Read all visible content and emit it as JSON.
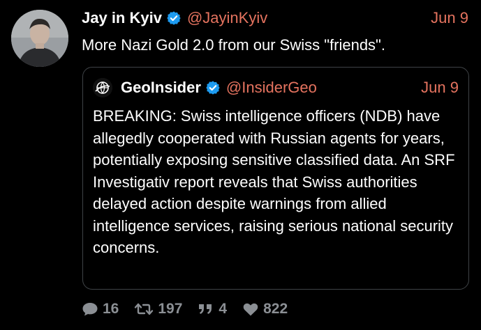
{
  "tweet": {
    "author_name": "Jay in Kyiv",
    "author_handle": "@JayinKyiv",
    "date": "Jun 9",
    "text": "More Nazi Gold 2.0 from our Swiss \"friends\".",
    "avatar_icon": "person-photo-avatar",
    "verified_icon": "verified-badge-icon"
  },
  "quoted": {
    "author_name": "GeoInsider",
    "author_handle": "@InsiderGeo",
    "date": "Jun 9",
    "avatar_icon": "globe-logo-avatar",
    "text": "BREAKING: Swiss intelligence officers (NDB) have allegedly cooperated with Russian agents for years, potentially exposing sensitive classified data. An SRF Investigativ report reveals that Swiss authorities delayed action despite warnings from allied intelligence services, raising serious national security concerns."
  },
  "actions": {
    "replies": "16",
    "retweets": "197",
    "quotes": "4",
    "likes": "822"
  },
  "colors": {
    "background": "#000000",
    "accent": "#e5735f",
    "verified": "#1d9bf0",
    "muted": "#8b8f94",
    "border": "#3f4347"
  }
}
